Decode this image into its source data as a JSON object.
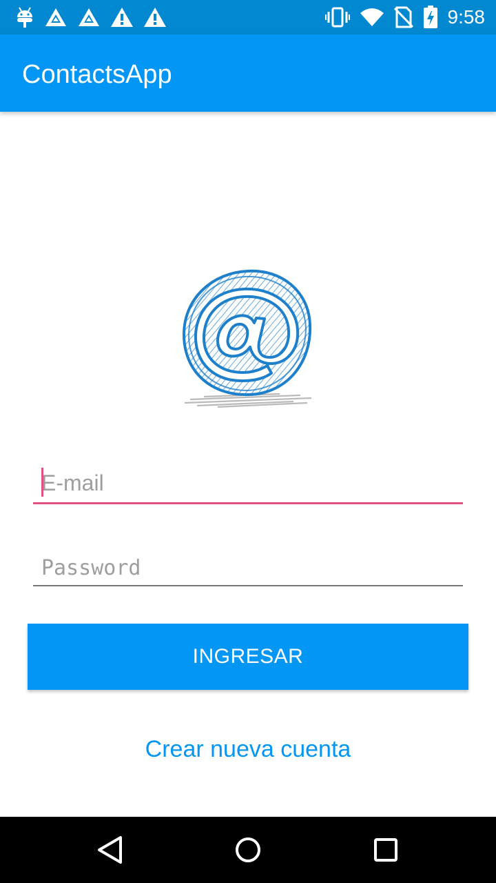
{
  "status_bar": {
    "time": "9:58",
    "left_icons": [
      "android-debug-icon",
      "triangle-app-icon",
      "triangle-app-icon",
      "warning-icon",
      "warning-icon"
    ],
    "right_icons": [
      "vibrate-icon",
      "wifi-icon",
      "no-sim-icon",
      "battery-charging-icon"
    ]
  },
  "app_bar": {
    "title": "ContactsApp"
  },
  "logo": {
    "icon": "at-sign-logo-icon",
    "color": "#1e7fcb"
  },
  "form": {
    "email_placeholder": "E-mail",
    "email_value": "",
    "password_placeholder": "Password",
    "password_value": "",
    "submit_label": "INGRESAR",
    "create_account_label": "Crear nueva cuenta"
  },
  "colors": {
    "status_bar": "#0288d1",
    "primary": "#0396f5",
    "accent": "#e05283"
  },
  "nav_bar": {
    "buttons": [
      "back-icon",
      "home-icon",
      "recents-icon"
    ]
  }
}
